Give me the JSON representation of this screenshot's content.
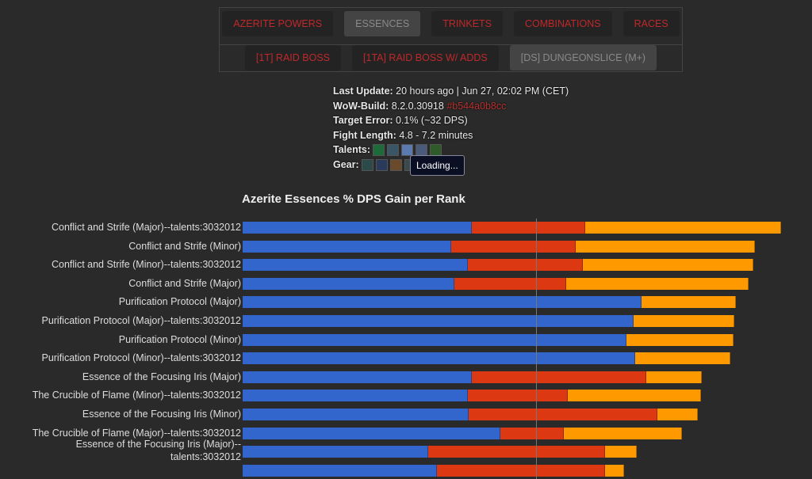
{
  "nav": {
    "row1": [
      {
        "label": "Azerite Powers",
        "active": false
      },
      {
        "label": "Essences",
        "active": true
      },
      {
        "label": "Trinkets",
        "active": false
      },
      {
        "label": "Combinations",
        "active": false
      },
      {
        "label": "Races",
        "active": false
      }
    ],
    "row2": [
      {
        "label": "[1T] Raid Boss",
        "active": false
      },
      {
        "label": "[1TA] Raid Boss w/ Adds",
        "active": false
      },
      {
        "label": "[DS] DungeonSlice (M+)",
        "active": true
      }
    ]
  },
  "info": {
    "last_update_label": "Last Update:",
    "last_update_value": " 20 hours ago | Jun 27, 02:02 PM (CET)",
    "build_label": "WoW-Build:",
    "build_value": " 8.2.0.30918 ",
    "build_hash": "#b544a0b8cc",
    "target_error_label": "Target Error:",
    "target_error_value": " 0.1% (~32 DPS)",
    "fight_length_label": "Fight Length:",
    "fight_length_value": " 4.8 - 7.2 minutes",
    "talents_label": "Talents:",
    "gear_label": "Gear:",
    "tooltip": "Loading..."
  },
  "chart_data": {
    "type": "bar",
    "orientation": "horizontal",
    "stacked": true,
    "title": "Azerite Essences % DPS Gain per Rank",
    "xlim": [
      0,
      100
    ],
    "reference_line_x": 53.3,
    "colors": [
      "#3366cc",
      "#dc3912",
      "#ff9900"
    ],
    "categories": [
      "Conflict and Strife (Major)--talents:3032012",
      "Conflict and Strife (Minor)",
      "Conflict and Strife (Minor)--talents:3032012",
      "Conflict and Strife (Major)",
      "Purification Protocol (Major)",
      "Purification Protocol (Major)--talents:3032012",
      "Purification Protocol (Minor)",
      "Purification Protocol (Minor)--talents:3032012",
      "Essence of the Focusing Iris (Major)",
      "The Crucible of Flame (Minor)--talents:3032012",
      "Essence of the Focusing Iris (Minor)",
      "The Crucible of Flame (Major)--talents:3032012",
      "Essence of the Focusing Iris (Major)--talents:3032012",
      ""
    ],
    "series": [
      {
        "values": [
          41.6,
          37.9,
          40.9,
          38.5,
          72.5,
          71.0,
          69.7,
          71.3,
          41.6,
          40.9,
          41.1,
          46.8,
          33.7,
          35.3
        ]
      },
      {
        "values": [
          20.7,
          22.6,
          20.9,
          20.3,
          0,
          0,
          0,
          0,
          31.8,
          18.2,
          34.3,
          11.5,
          32.1,
          30.5
        ]
      },
      {
        "values": [
          35.6,
          32.6,
          31.0,
          33.1,
          17.1,
          18.4,
          19.5,
          17.3,
          10.1,
          24.2,
          7.3,
          21.5,
          5.8,
          3.5
        ]
      }
    ]
  }
}
